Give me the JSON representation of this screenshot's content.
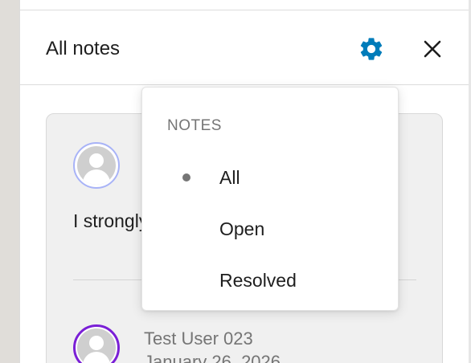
{
  "header": {
    "title": "All notes",
    "settings_icon": "gear-icon",
    "close_icon": "close-icon",
    "accent_color": "#007cba"
  },
  "note_card": {
    "text": "I strongly",
    "reply_author": "Test User 023",
    "reply_date": "January 26, 2026"
  },
  "filter_menu": {
    "heading": "NOTES",
    "items": [
      {
        "label": "All",
        "selected": true
      },
      {
        "label": "Open",
        "selected": false
      },
      {
        "label": "Resolved",
        "selected": false
      }
    ]
  }
}
